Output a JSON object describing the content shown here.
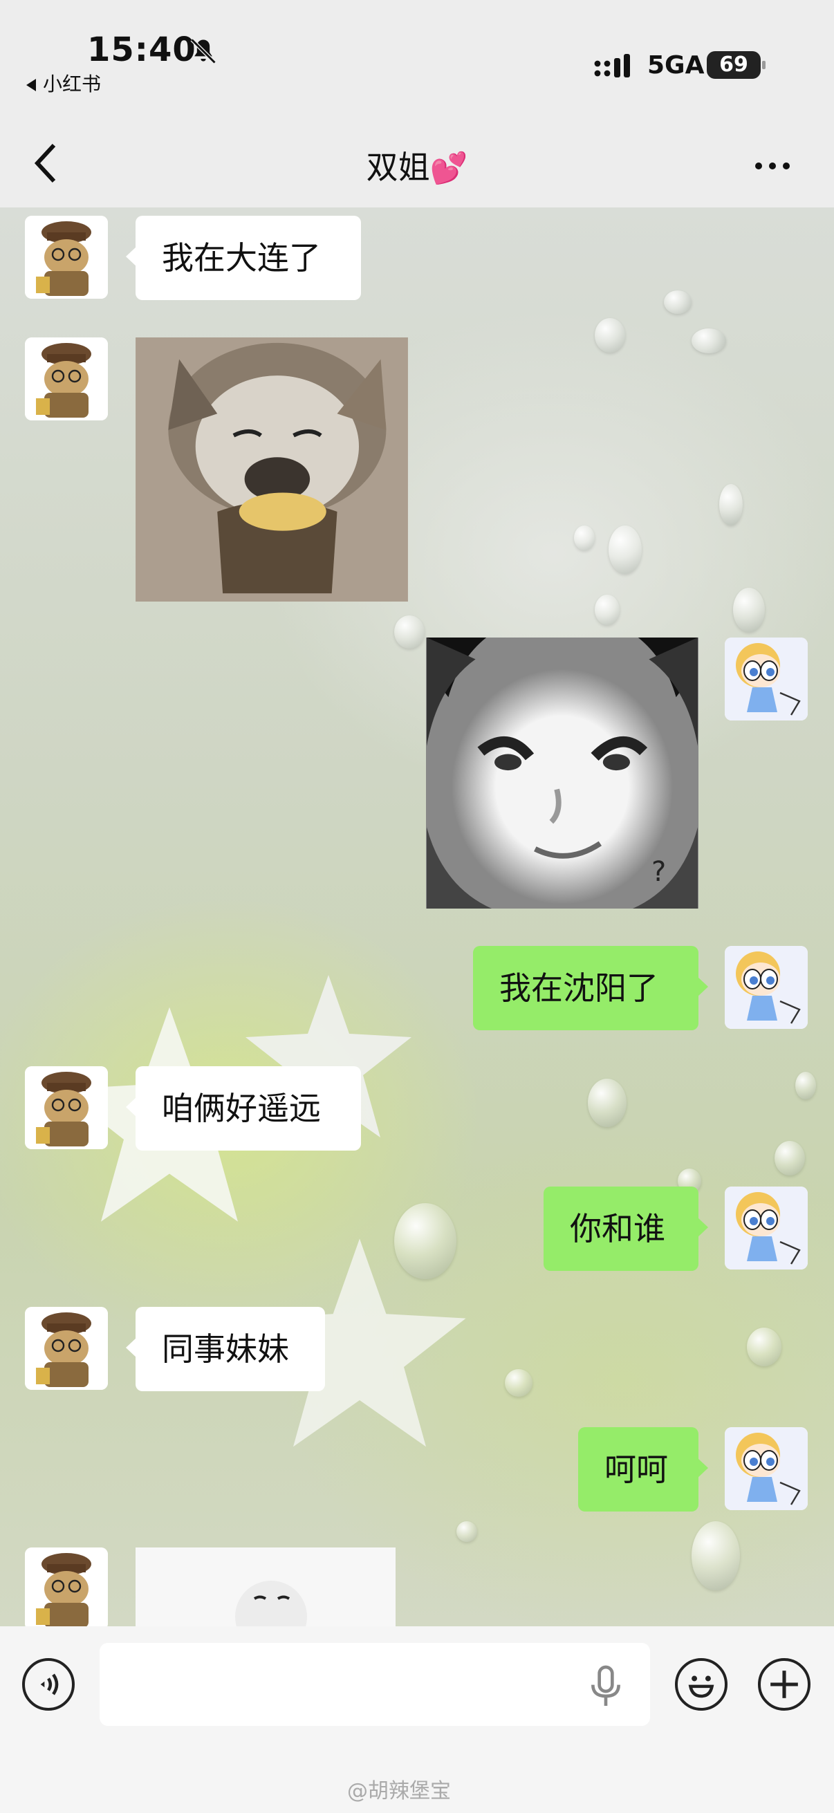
{
  "status_bar": {
    "time": "15:40",
    "back_app": "小红书",
    "network": "5GA",
    "battery": "69"
  },
  "nav": {
    "title": "双姐",
    "title_emoji": "💕"
  },
  "messages": [
    {
      "side": "left",
      "type": "text",
      "text": "我在大连了",
      "avatar": "cat-avatar"
    },
    {
      "side": "left",
      "type": "image",
      "image": "cat-eating-sweet-potato-sticker",
      "avatar": "cat-avatar"
    },
    {
      "side": "right",
      "type": "image",
      "image": "panda-face-meme-sticker",
      "caption": "?",
      "avatar": "powerpuff-avatar"
    },
    {
      "side": "right",
      "type": "text",
      "text": "我在沈阳了",
      "avatar": "powerpuff-avatar"
    },
    {
      "side": "left",
      "type": "text",
      "text": "咱俩好遥远",
      "avatar": "cat-avatar"
    },
    {
      "side": "right",
      "type": "text",
      "text": "你和谁",
      "avatar": "powerpuff-avatar"
    },
    {
      "side": "left",
      "type": "text",
      "text": "同事妹妹",
      "avatar": "cat-avatar"
    },
    {
      "side": "right",
      "type": "text",
      "text": "呵呵",
      "avatar": "powerpuff-avatar"
    },
    {
      "side": "left",
      "type": "image",
      "image": "white-ball-face-sticker",
      "avatar": "cat-avatar"
    }
  ],
  "input_bar": {
    "voice_icon": "voice-mode-icon",
    "placeholder": "",
    "mic_icon": "microphone-icon",
    "emoji_icon": "emoji-icon",
    "plus_icon": "plus-icon"
  },
  "watermark": "@胡辣堡宝",
  "colors": {
    "sent_bubble": "#95ec69",
    "received_bubble": "#ffffff",
    "title_heart": "#ff3d9a"
  }
}
